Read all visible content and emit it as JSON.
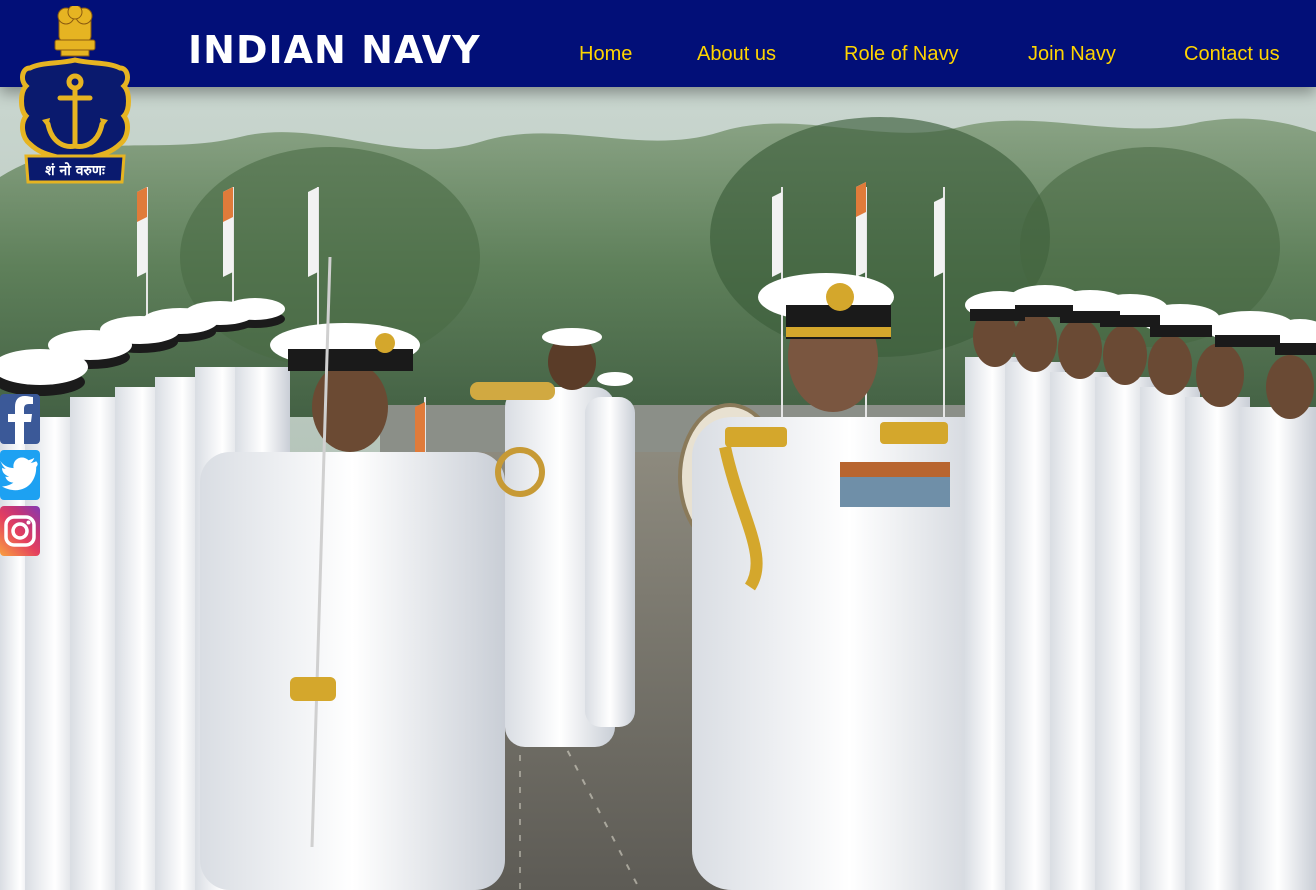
{
  "brand": {
    "title": "INDIAN NAVY",
    "logo_motto": "शं नो वरुणः"
  },
  "nav": {
    "items": [
      {
        "label": "Home"
      },
      {
        "label": "About us"
      },
      {
        "label": "Role of Navy"
      },
      {
        "label": "Join Navy"
      },
      {
        "label": "Contact us"
      }
    ]
  },
  "social": {
    "items": [
      {
        "icon": "facebook-icon"
      },
      {
        "icon": "twitter-icon"
      },
      {
        "icon": "instagram-icon"
      }
    ]
  },
  "hero": {
    "image": "naval-parade-photo"
  },
  "colors": {
    "navbar_bg": "#020f78",
    "nav_link": "#ffd400",
    "brand_text": "#ffffff",
    "logo_gold": "#e6b422",
    "facebook": "#3b5998",
    "twitter": "#1da1f2"
  }
}
